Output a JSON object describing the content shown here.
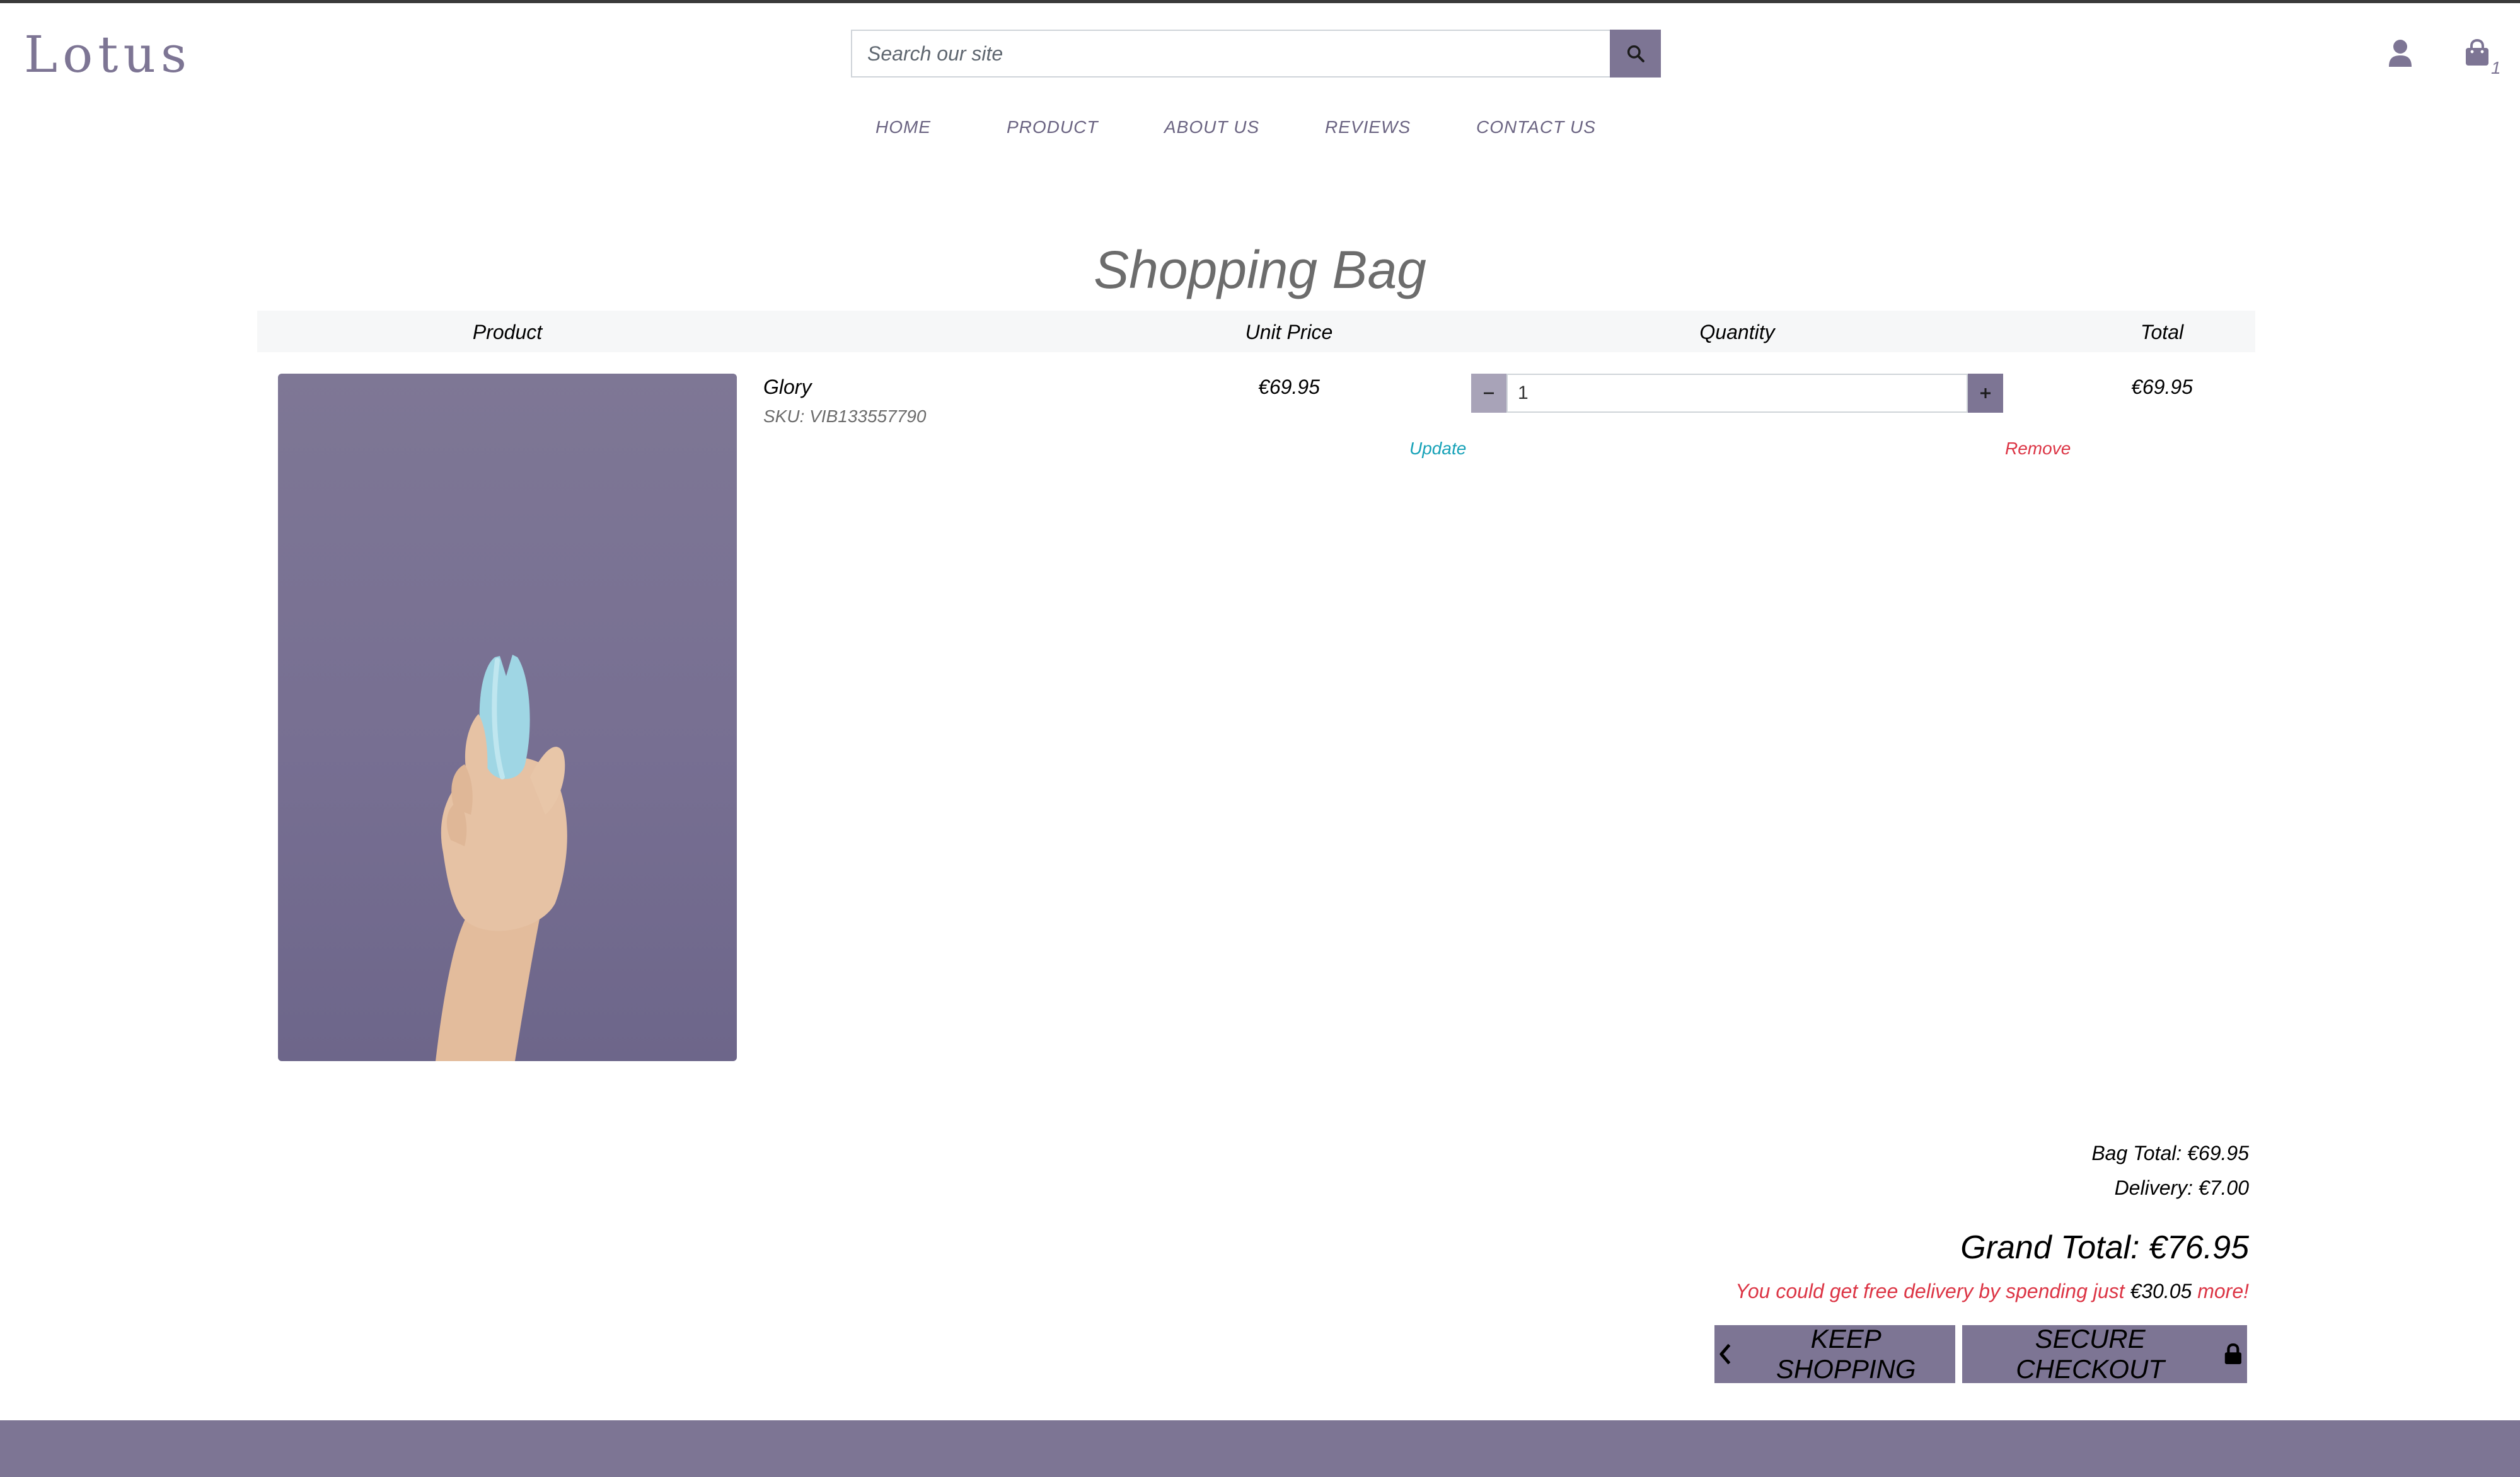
{
  "brand": {
    "name": "Lotus",
    "color": "#7d7594"
  },
  "search": {
    "placeholder": "Search our site"
  },
  "header": {
    "bag_count": "1"
  },
  "nav": {
    "items": [
      {
        "label": "HOME"
      },
      {
        "label": "PRODUCT"
      },
      {
        "label": "ABOUT US"
      },
      {
        "label": "REVIEWS"
      },
      {
        "label": "CONTACT US"
      }
    ]
  },
  "page": {
    "title": "Shopping Bag"
  },
  "table": {
    "headers": {
      "product": "Product",
      "unit_price": "Unit Price",
      "quantity": "Quantity",
      "total": "Total"
    }
  },
  "item": {
    "name": "Glory",
    "sku": "SKU: VIB133557790",
    "unit_price": "€69.95",
    "quantity": "1",
    "total": "€69.95",
    "update_label": "Update",
    "remove_label": "Remove"
  },
  "summary": {
    "bag_total": "Bag Total: €69.95",
    "delivery": "Delivery: €7.00",
    "grand_total": "Grand Total: €76.95",
    "free_delivery_prefix": "You could get free delivery by spending just",
    "free_delivery_amount": "€30.05",
    "free_delivery_suffix": "more!"
  },
  "actions": {
    "keep_shopping": "KEEP SHOPPING",
    "secure_checkout": "SECURE CHECKOUT"
  },
  "icons": {
    "search": "search-icon",
    "user": "user-icon",
    "bag": "shopping-bag-icon",
    "minus": "minus-icon",
    "plus": "plus-icon",
    "chevron": "chevron-left-icon",
    "lock": "lock-icon"
  },
  "colors": {
    "accent": "#7d7594",
    "update": "#17a2b8",
    "remove": "#dc3545"
  }
}
